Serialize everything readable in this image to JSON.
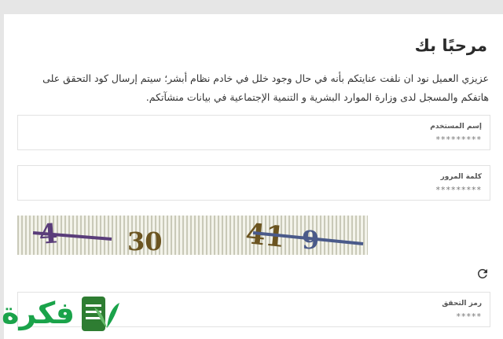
{
  "page": {
    "title": "مرحبًا بك",
    "intro": "عزيزي العميل نود ان نلفت عنايتكم بأنه في حال وجود خلل في خادم نظام أبشر؛ سيتم إرسال كود التحقق على هاتفكم والمسجل لدى وزارة الموارد البشرية و التنمية الإجتماعية في بيانات منشآتكم."
  },
  "fields": {
    "username": {
      "label": "إسم المستخدم",
      "value": "*********"
    },
    "password": {
      "label": "كلمة المرور",
      "value": "*********"
    },
    "code": {
      "label": "رمز التحقق",
      "value": "*****"
    }
  },
  "captcha": {
    "text": "4 30 419"
  },
  "icons": {
    "refresh": "refresh-icon"
  },
  "logo": {
    "text": "فكرة"
  },
  "colors": {
    "brand": "#1aa34a",
    "brand_dark": "#2e7d32"
  }
}
